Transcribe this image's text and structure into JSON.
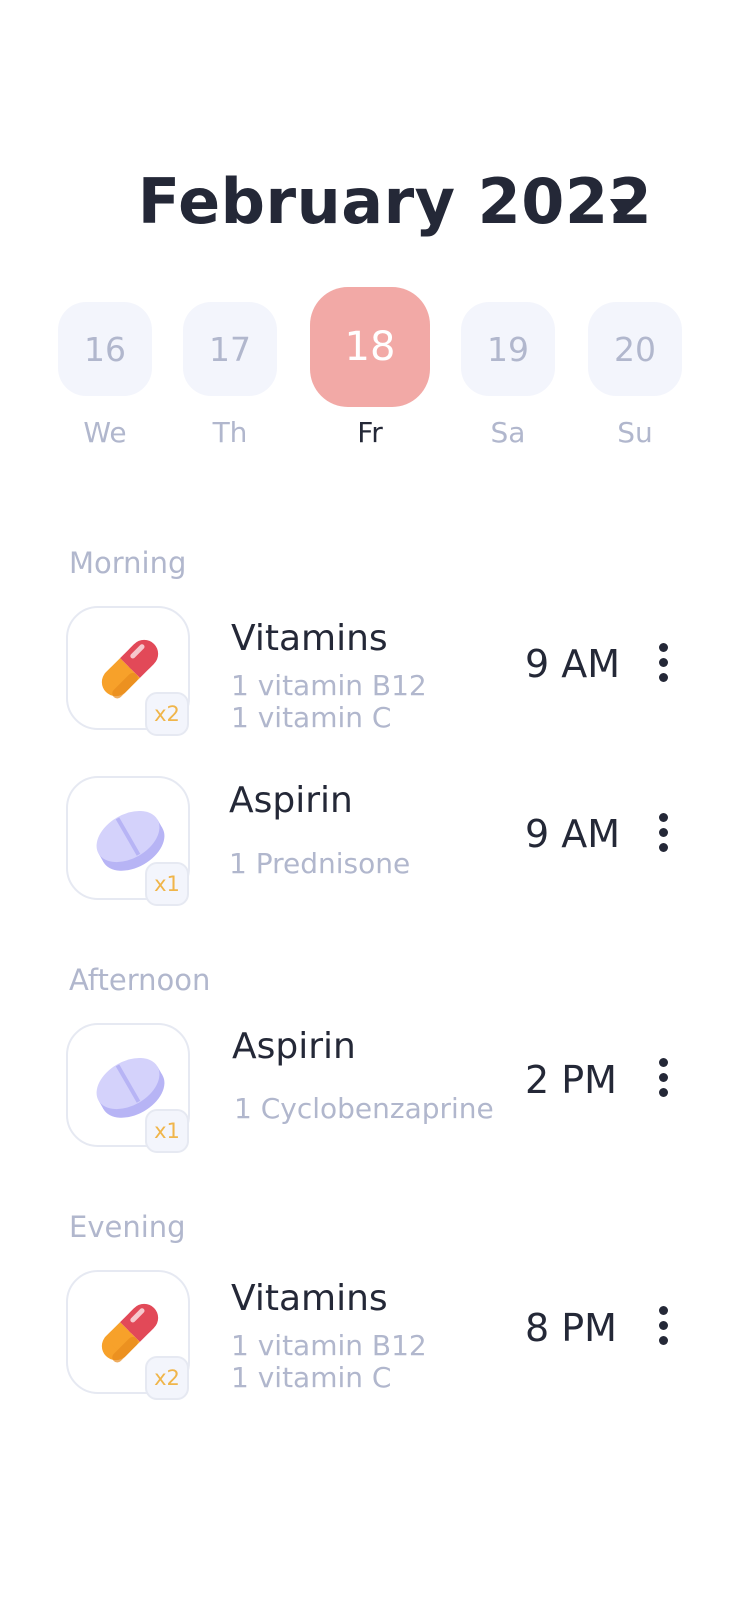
{
  "header": {
    "month_label": "February 2022",
    "caret_icon": "caret-down-icon"
  },
  "days": [
    {
      "number": "16",
      "weekday": "We",
      "selected": false
    },
    {
      "number": "17",
      "weekday": "Th",
      "selected": false
    },
    {
      "number": "18",
      "weekday": "Fr",
      "selected": true
    },
    {
      "number": "19",
      "weekday": "Sa",
      "selected": false
    },
    {
      "number": "20",
      "weekday": "Su",
      "selected": false
    }
  ],
  "sections": {
    "morning": "Morning",
    "afternoon": "Afternoon",
    "evening": "Evening"
  },
  "meds": [
    {
      "name": "Vitamins",
      "details": [
        "1 vitamin B12",
        "1 vitamin C"
      ],
      "time": "9 AM",
      "count": "x2",
      "icon": "capsule-icon"
    },
    {
      "name": "Aspirin",
      "details": [
        "1 Prednisone"
      ],
      "time": "9 AM",
      "count": "x1",
      "icon": "tablet-icon"
    },
    {
      "name": "Aspirin",
      "details": [
        "1 Cyclobenzaprine"
      ],
      "time": "2 PM",
      "count": "x1",
      "icon": "tablet-icon"
    },
    {
      "name": "Vitamins",
      "details": [
        "1 vitamin B12",
        "1 vitamin C"
      ],
      "time": "8 PM",
      "count": "x2",
      "icon": "capsule-icon"
    }
  ],
  "colors": {
    "accent": "#f2a9a6",
    "text": "#242837",
    "muted": "#b1b7cd",
    "badge_text": "#f0b54a",
    "pill_bg": "#f3f5fc"
  }
}
